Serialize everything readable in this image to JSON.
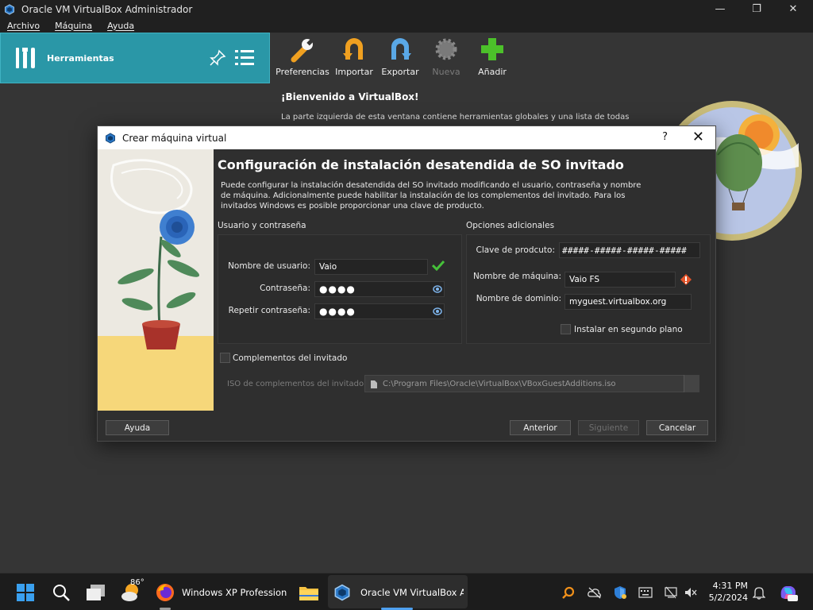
{
  "window": {
    "title": "Oracle VM VirtualBox Administrador",
    "controls": {
      "minimize": "—",
      "maximize": "❐",
      "close": "✕"
    }
  },
  "menu": [
    "Archivo",
    "Máquina",
    "Ayuda"
  ],
  "tools": {
    "label": "Herramientas"
  },
  "toolbar": {
    "preferences": "Preferencias",
    "import": "Importar",
    "export": "Exportar",
    "new": "Nueva",
    "add": "Añadir"
  },
  "welcome": {
    "title": "¡Bienvenido a VirtualBox!",
    "text": "La parte izquierda de esta ventana contiene herramientas globales y una lista de todas las"
  },
  "dialog": {
    "title": "Crear máquina virtual",
    "help_glyph": "?",
    "close_glyph": "✕",
    "heading": "Configuración de instalación desatendida de SO invitado",
    "description": "Puede configurar la instalación desatendida del SO invitado modificando el usuario, contraseña y nombre de máquina. Adicionalmente puede habilitar la instalación de los complementos del invitado. Para los invitados Windows es posible proporcionar una clave de producto.",
    "user_group": {
      "title": "Usuario y contraseña",
      "username_label": "Nombre de usuario:",
      "username_value": "Vaio",
      "password_label": "Contraseña:",
      "password_value": "●●●●",
      "repeat_label": "Repetir contraseña:",
      "repeat_value": "●●●●"
    },
    "additional_group": {
      "title": "Opciones adicionales",
      "product_key_label": "Clave de prodcuto:",
      "product_key_value": "#####-#####-#####-#####",
      "hostname_label": "Nombre de máquina:",
      "hostname_value": "Vaio FS",
      "domain_label": "Nombre de dominio:",
      "domain_value": "myguest.virtualbox.org",
      "background_label": "Instalar en segundo plano"
    },
    "guest_additions": {
      "label": "Complementos del invitado",
      "iso_label": "ISO de complementos del invitado:",
      "iso_value": "C:\\Program Files\\Oracle\\VirtualBox\\VBoxGuestAdditions.iso"
    },
    "buttons": {
      "help": "Ayuda",
      "back": "Anterior",
      "next": "Siguiente",
      "cancel": "Cancelar"
    }
  },
  "taskbar": {
    "weather_temp": "86°",
    "firefox_label": "Windows XP Profession",
    "vbox_label": "Oracle VM VirtualBox Ad",
    "time": "4:31 PM",
    "date": "5/2/2024"
  }
}
